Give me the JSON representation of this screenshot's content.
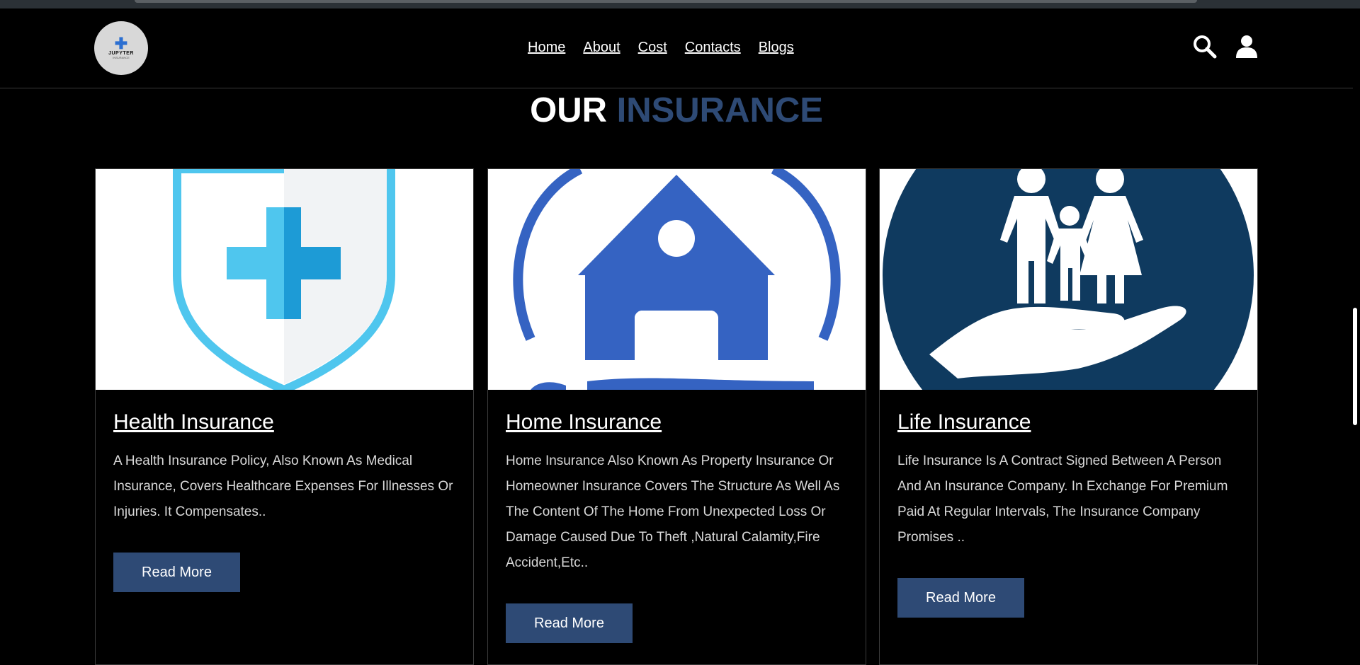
{
  "logo": {
    "mark": "✚",
    "name": "JUPYTER",
    "sub": "INSURANCE"
  },
  "nav": {
    "items": [
      "Home",
      "About",
      "Cost",
      "Contacts",
      "Blogs"
    ]
  },
  "header_icons": [
    "search-icon",
    "user-icon"
  ],
  "heading": {
    "word1": "OUR",
    "word2": "INSURANCE"
  },
  "colors": {
    "accent": "#2e4a75",
    "health_light": "#4fc6ee",
    "home_blue": "#3563c2",
    "life_navy": "#0f3a5f"
  },
  "cards": [
    {
      "title": "Health Insurance",
      "description": "A Health Insurance Policy, Also Known As Medical Insurance, Covers Healthcare Expenses For Illnesses Or Injuries. It Compensates..",
      "button": "Read More",
      "icon": "shield-plus-icon"
    },
    {
      "title": "Home Insurance",
      "description": "Home Insurance Also Known As Property Insurance Or Homeowner Insurance Covers The Structure As Well As The Content Of The Home From Unexpected Loss Or Damage Caused Due To Theft ,Natural Calamity,Fire Accident,Etc..",
      "button": "Read More",
      "icon": "house-icon"
    },
    {
      "title": "Life Insurance",
      "description": "Life Insurance Is A Contract Signed Between A Person And An Insurance Company. In Exchange For Premium Paid At Regular Intervals, The Insurance Company Promises ..",
      "button": "Read More",
      "icon": "family-hand-icon"
    }
  ]
}
